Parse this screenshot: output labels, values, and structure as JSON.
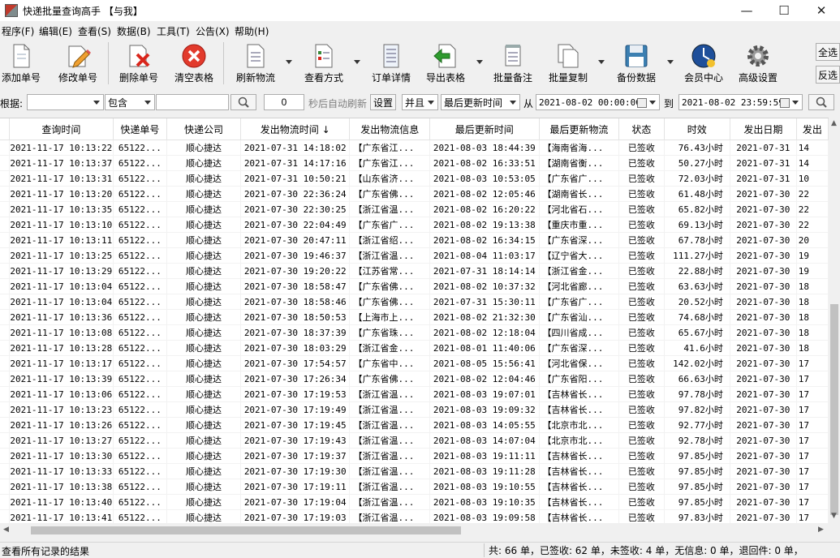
{
  "window": {
    "title": "快递批量查询高手 【与我】",
    "controls": {
      "minimize": "—",
      "maximize": "☐",
      "close": "✕"
    }
  },
  "menu": [
    "程序(F)",
    "编辑(E)",
    "查看(S)",
    "数据(B)",
    "工具(T)",
    "公告(X)",
    "帮助(H)"
  ],
  "toolbar": {
    "add": "添加单号",
    "edit": "修改单号",
    "delete": "删除单号",
    "clear": "清空表格",
    "refresh": "刷新物流",
    "view_mode": "查看方式",
    "order_detail": "订单详情",
    "export": "导出表格",
    "batch_note": "批量备注",
    "batch_copy": "批量复制",
    "backup": "备份数据",
    "member": "会员中心",
    "advanced": "高级设置",
    "select_all": "全选",
    "invert": "反选"
  },
  "filter": {
    "by_label": "根据:",
    "by_value": "",
    "match_value": "包含",
    "keyword": "",
    "interval": "0",
    "auto_refresh_label": "秒后自动刷新",
    "settings_btn": "设置",
    "logic_value": "并且",
    "time_field_value": "最后更新时间",
    "from_label": "从",
    "from_value": "2021-08-02 00:00:00",
    "to_label": "到",
    "to_value": "2021-08-02 23:59:59"
  },
  "table": {
    "columns": [
      "",
      "查询时间",
      "快递单号",
      "快递公司",
      "发出物流时间 ↓",
      "发出物流信息",
      "最后更新时间",
      "最后更新物流",
      "状态",
      "时效",
      "发出日期",
      "发出"
    ],
    "rows": [
      [
        "2021-11-17 10:13:22",
        "65122...",
        "顺心捷达",
        "2021-07-31 14:18:02",
        "【广东省江...",
        "2021-08-03 18:44:39",
        "【海南省海...",
        "已签收",
        "76.43小时",
        "2021-07-31",
        "14"
      ],
      [
        "2021-11-17 10:13:37",
        "65122...",
        "顺心捷达",
        "2021-07-31 14:17:16",
        "【广东省江...",
        "2021-08-02 16:33:51",
        "【湖南省衡...",
        "已签收",
        "50.27小时",
        "2021-07-31",
        "14"
      ],
      [
        "2021-11-17 10:13:31",
        "65122...",
        "顺心捷达",
        "2021-07-31 10:50:21",
        "【山东省济...",
        "2021-08-03 10:53:05",
        "【广东省广...",
        "已签收",
        "72.03小时",
        "2021-07-31",
        "10"
      ],
      [
        "2021-11-17 10:13:20",
        "65122...",
        "顺心捷达",
        "2021-07-30 22:36:24",
        "【广东省佛...",
        "2021-08-02 12:05:46",
        "【湖南省长...",
        "已签收",
        "61.48小时",
        "2021-07-30",
        "22"
      ],
      [
        "2021-11-17 10:13:35",
        "65122...",
        "顺心捷达",
        "2021-07-30 22:30:25",
        "【浙江省温...",
        "2021-08-02 16:20:22",
        "【河北省石...",
        "已签收",
        "65.82小时",
        "2021-07-30",
        "22"
      ],
      [
        "2021-11-17 10:13:10",
        "65122...",
        "顺心捷达",
        "2021-07-30 22:04:49",
        "【广东省广...",
        "2021-08-02 19:13:38",
        "【重庆市重...",
        "已签收",
        "69.13小时",
        "2021-07-30",
        "22"
      ],
      [
        "2021-11-17 10:13:11",
        "65122...",
        "顺心捷达",
        "2021-07-30 20:47:11",
        "【浙江省绍...",
        "2021-08-02 16:34:15",
        "【广东省深...",
        "已签收",
        "67.78小时",
        "2021-07-30",
        "20"
      ],
      [
        "2021-11-17 10:13:25",
        "65122...",
        "顺心捷达",
        "2021-07-30 19:46:37",
        "【浙江省温...",
        "2021-08-04 11:03:17",
        "【辽宁省大...",
        "已签收",
        "111.27小时",
        "2021-07-30",
        "19"
      ],
      [
        "2021-11-17 10:13:29",
        "65122...",
        "顺心捷达",
        "2021-07-30 19:20:22",
        "【江苏省常...",
        "2021-07-31 18:14:14",
        "【浙江省金...",
        "已签收",
        "22.88小时",
        "2021-07-30",
        "19"
      ],
      [
        "2021-11-17 10:13:04",
        "65122...",
        "顺心捷达",
        "2021-07-30 18:58:47",
        "【广东省佛...",
        "2021-08-02 10:37:32",
        "【河北省廊...",
        "已签收",
        "63.63小时",
        "2021-07-30",
        "18"
      ],
      [
        "2021-11-17 10:13:04",
        "65122...",
        "顺心捷达",
        "2021-07-30 18:58:46",
        "【广东省佛...",
        "2021-07-31 15:30:11",
        "【广东省广...",
        "已签收",
        "20.52小时",
        "2021-07-30",
        "18"
      ],
      [
        "2021-11-17 10:13:36",
        "65122...",
        "顺心捷达",
        "2021-07-30 18:50:53",
        "【上海市上...",
        "2021-08-02 21:32:30",
        "【广东省汕...",
        "已签收",
        "74.68小时",
        "2021-07-30",
        "18"
      ],
      [
        "2021-11-17 10:13:08",
        "65122...",
        "顺心捷达",
        "2021-07-30 18:37:39",
        "【广东省珠...",
        "2021-08-02 12:18:04",
        "【四川省成...",
        "已签收",
        "65.67小时",
        "2021-07-30",
        "18"
      ],
      [
        "2021-11-17 10:13:28",
        "65122...",
        "顺心捷达",
        "2021-07-30 18:03:29",
        "【浙江省金...",
        "2021-08-01 11:40:06",
        "【广东省深...",
        "已签收",
        "41.6小时",
        "2021-07-30",
        "18"
      ],
      [
        "2021-11-17 10:13:17",
        "65122...",
        "顺心捷达",
        "2021-07-30 17:54:57",
        "【广东省中...",
        "2021-08-05 15:56:41",
        "【河北省保...",
        "已签收",
        "142.02小时",
        "2021-07-30",
        "17"
      ],
      [
        "2021-11-17 10:13:39",
        "65122...",
        "顺心捷达",
        "2021-07-30 17:26:34",
        "【广东省佛...",
        "2021-08-02 12:04:46",
        "【广东省阳...",
        "已签收",
        "66.63小时",
        "2021-07-30",
        "17"
      ],
      [
        "2021-11-17 10:13:06",
        "65122...",
        "顺心捷达",
        "2021-07-30 17:19:53",
        "【浙江省温...",
        "2021-08-03 19:07:01",
        "【吉林省长...",
        "已签收",
        "97.78小时",
        "2021-07-30",
        "17"
      ],
      [
        "2021-11-17 10:13:23",
        "65122...",
        "顺心捷达",
        "2021-07-30 17:19:49",
        "【浙江省温...",
        "2021-08-03 19:09:32",
        "【吉林省长...",
        "已签收",
        "97.82小时",
        "2021-07-30",
        "17"
      ],
      [
        "2021-11-17 10:13:26",
        "65122...",
        "顺心捷达",
        "2021-07-30 17:19:45",
        "【浙江省温...",
        "2021-08-03 14:05:55",
        "【北京市北...",
        "已签收",
        "92.77小时",
        "2021-07-30",
        "17"
      ],
      [
        "2021-11-17 10:13:27",
        "65122...",
        "顺心捷达",
        "2021-07-30 17:19:43",
        "【浙江省温...",
        "2021-08-03 14:07:04",
        "【北京市北...",
        "已签收",
        "92.78小时",
        "2021-07-30",
        "17"
      ],
      [
        "2021-11-17 10:13:30",
        "65122...",
        "顺心捷达",
        "2021-07-30 17:19:37",
        "【浙江省温...",
        "2021-08-03 19:11:11",
        "【吉林省长...",
        "已签收",
        "97.85小时",
        "2021-07-30",
        "17"
      ],
      [
        "2021-11-17 10:13:33",
        "65122...",
        "顺心捷达",
        "2021-07-30 17:19:30",
        "【浙江省温...",
        "2021-08-03 19:11:28",
        "【吉林省长...",
        "已签收",
        "97.85小时",
        "2021-07-30",
        "17"
      ],
      [
        "2021-11-17 10:13:38",
        "65122...",
        "顺心捷达",
        "2021-07-30 17:19:11",
        "【浙江省温...",
        "2021-08-03 19:10:55",
        "【吉林省长...",
        "已签收",
        "97.85小时",
        "2021-07-30",
        "17"
      ],
      [
        "2021-11-17 10:13:40",
        "65122...",
        "顺心捷达",
        "2021-07-30 17:19:04",
        "【浙江省温...",
        "2021-08-03 19:10:35",
        "【吉林省长...",
        "已签收",
        "97.85小时",
        "2021-07-30",
        "17"
      ],
      [
        "2021-11-17 10:13:41",
        "65122...",
        "顺心捷达",
        "2021-07-30 17:19:03",
        "【浙江省温...",
        "2021-08-03 19:09:58",
        "【吉林省长...",
        "已签收",
        "97.83小时",
        "2021-07-30",
        "17"
      ]
    ]
  },
  "status": {
    "left": "查看所有记录的结果",
    "right": "共: 66 单，已签收: 62 单，未签收: 4 单，无信息: 0 单，退回件: 0 单，"
  },
  "colors": {
    "accent": "#3c7fb1",
    "delete_red": "#d9261c",
    "export_green": "#2e9b2e"
  }
}
